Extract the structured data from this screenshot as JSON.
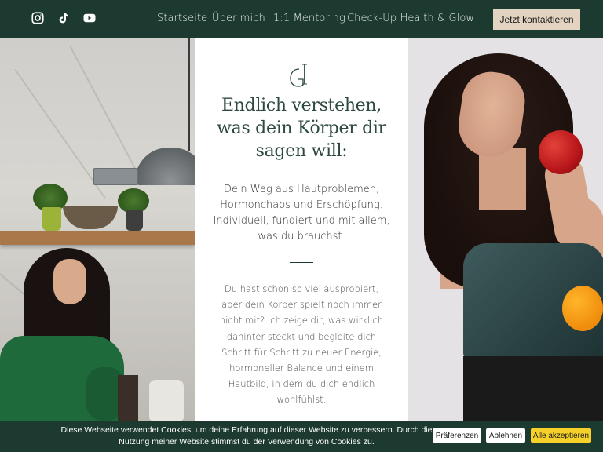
{
  "nav": {
    "social": [
      {
        "icon": "instagram-icon"
      },
      {
        "icon": "tiktok-icon"
      },
      {
        "icon": "youtube-icon"
      }
    ],
    "links": [
      "Startseite",
      "Über mich",
      "1:1 Mentoring",
      "Check-Up Health & Glow"
    ],
    "cta": "Jetzt kontaktieren"
  },
  "hero": {
    "logo": "GH monogram",
    "headline": "Endlich verstehen, was dein Körper dir sagen will:",
    "subline": "Dein Weg aus Hautproblemen, Hormonchaos und Erschöpfung. Individuell, fundiert und mit allem, was du brauchst.",
    "body": "Du hast schon so viel ausprobiert, aber dein Körper spielt noch immer nicht mit? Ich zeige dir, was wirklich dahinter steckt und begleite dich Schritt für Schritt zu neuer Energie, hormoneller Balance und einem Hautbild, in dem du dich endlich wohlfühlst."
  },
  "cookie": {
    "text": "Diese Webseite verwendet Cookies, um deine Erfahrung auf dieser Website zu verbessern. Durch die Nutzung meiner Website stimmst du der Verwendung von Cookies zu.",
    "preferences": "Präferenzen",
    "decline": "Ablehnen",
    "accept": "Alle akzeptieren"
  },
  "colors": {
    "brand_green": "#1d3a30",
    "cta_beige": "#e3d4c2",
    "accept_yellow": "#f5d12a",
    "headline_green": "#2e4a3f"
  }
}
